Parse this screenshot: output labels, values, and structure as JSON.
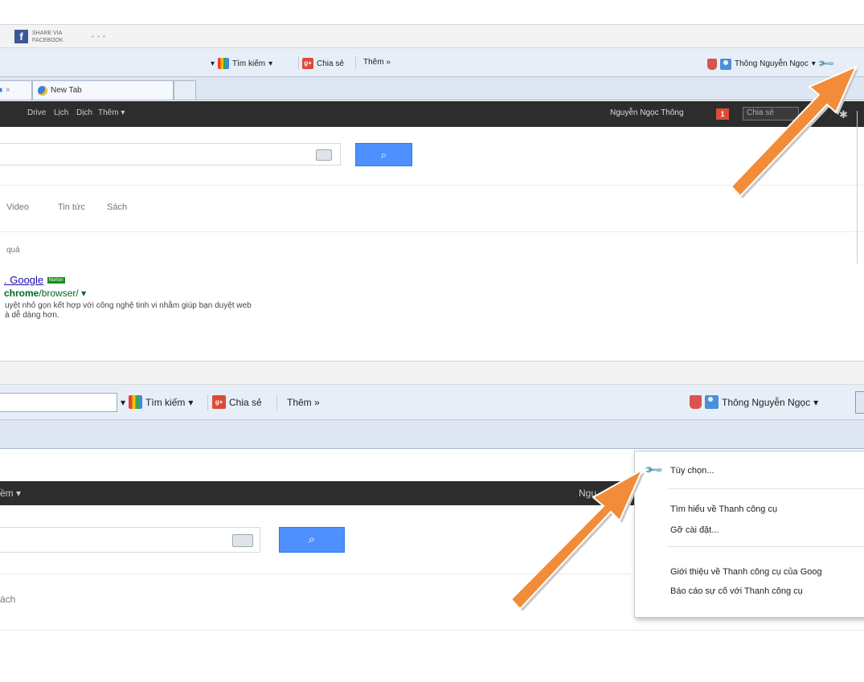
{
  "facebook": {
    "share_label": "SHARE VIA",
    "brand_label": "FACEBOOK",
    "dots": "• • •"
  },
  "toolbar": {
    "search_label": "Tìm kiếm",
    "dropdown_caret": "▾",
    "share_label": "Chia sẻ",
    "more_label": "Thêm »",
    "user_name": "Thông Nguyễn Ngọc"
  },
  "tabs": {
    "first_close": "×",
    "new_tab_label": "New Tab"
  },
  "google_bar": {
    "items": [
      "Drive",
      "Lịch",
      "Dịch",
      "Thêm ▾"
    ],
    "bottom_partial": "ềm ▾",
    "user_name": "Nguyễn Ngọc Thông",
    "notification_count": "1",
    "share_placeholder": "Chia sẻ",
    "user_partial": "Ngu"
  },
  "search": {
    "button_icon": "search-icon"
  },
  "nav_links": [
    "Video",
    "Tin tức",
    "Sách"
  ],
  "nav_partial": "ách",
  "results": {
    "stats": "quả",
    "title": "Google",
    "norton_badge": "Norton",
    "url_bold": "chrome",
    "url_rest": "/browser/",
    "snippet_line1": "uyệt nhỏ gọn kết hợp với công nghệ tinh vi nhằm giúp bạn duyệt web",
    "snippet_line2": "à dễ dàng hơn."
  },
  "menu": {
    "options": "Tùy chọn...",
    "learn": "Tìm hiểu về Thanh công cụ",
    "uninstall": "Gỡ cài đặt...",
    "about": "Giới thiệu về Thanh công cụ của Goog",
    "report": "Báo cáo sự cố với Thanh công cụ"
  },
  "colors": {
    "arrow": "#f28c38",
    "google_bar": "#2d2d2d",
    "search_button": "#4d90fe",
    "link": "#1a0dab",
    "url": "#006621"
  }
}
